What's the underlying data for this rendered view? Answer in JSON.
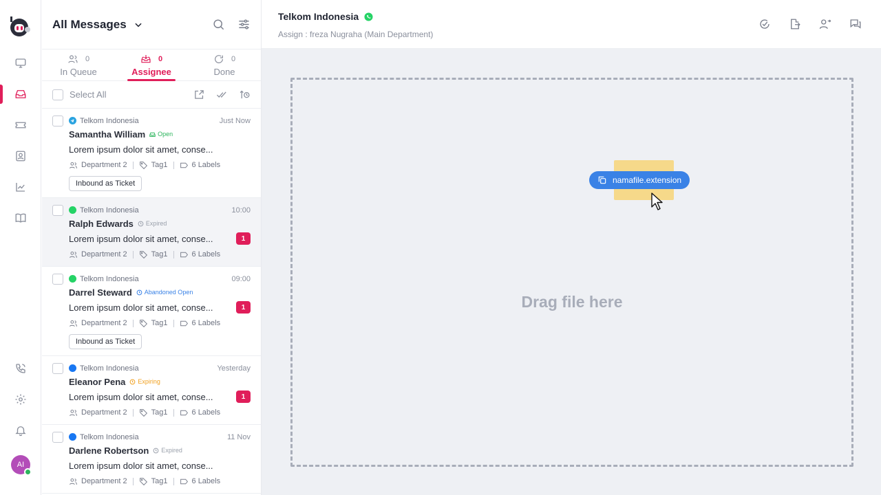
{
  "list": {
    "title": "All Messages",
    "tabs": [
      {
        "label": "In Queue",
        "count": "0"
      },
      {
        "label": "Assignee",
        "count": "0"
      },
      {
        "label": "Done",
        "count": "0"
      }
    ],
    "select_all": "Select All",
    "items": [
      {
        "source": "Telkom Indonesia",
        "channel": "telegram",
        "time": "Just Now",
        "name": "Samantha William",
        "status": "Open",
        "preview": "Lorem ipsum dolor sit amet, conse...",
        "badge": "",
        "department": "Department 2",
        "tag": "Tag1",
        "labels": "6 Labels",
        "action": "Inbound as Ticket"
      },
      {
        "source": "Telkom Indonesia",
        "channel": "whatsapp",
        "time": "10:00",
        "name": "Ralph Edwards",
        "status": "Expired",
        "preview": "Lorem ipsum dolor sit amet, conse...",
        "badge": "1",
        "department": "Department 2",
        "tag": "Tag1",
        "labels": "6 Labels",
        "action": ""
      },
      {
        "source": "Telkom Indonesia",
        "channel": "whatsapp",
        "time": "09:00",
        "name": "Darrel Steward",
        "status": "Abandoned Open",
        "preview": "Lorem ipsum dolor sit amet, conse...",
        "badge": "1",
        "department": "Department 2",
        "tag": "Tag1",
        "labels": "6 Labels",
        "action": "Inbound as Ticket"
      },
      {
        "source": "Telkom Indonesia",
        "channel": "facebook",
        "time": "Yesterday",
        "name": "Eleanor Pena",
        "status": "Expiring",
        "preview": "Lorem ipsum dolor sit amet, conse...",
        "badge": "1",
        "department": "Department 2",
        "tag": "Tag1",
        "labels": "6 Labels",
        "action": ""
      },
      {
        "source": "Telkom Indonesia",
        "channel": "facebook",
        "time": "11 Nov",
        "name": "Darlene Robertson",
        "status": "Expired",
        "preview": "Lorem ipsum dolor sit amet, conse...",
        "badge": "",
        "department": "Department 2",
        "tag": "Tag1",
        "labels": "6 Labels",
        "action": ""
      }
    ]
  },
  "chat": {
    "title": "Telkom Indonesia",
    "subtitle": "Assign : freza Nugraha (Main Department)"
  },
  "dropzone": {
    "text": "Drag file here",
    "file_name": "namafile.extension"
  },
  "user": {
    "initials": "AI"
  },
  "colors": {
    "accent": "#e01e5a",
    "chip": "#3a82e6",
    "open": "#2db55d",
    "expired": "#9aa0ab",
    "abandoned": "#3a82e6",
    "expiring": "#f0a020"
  }
}
